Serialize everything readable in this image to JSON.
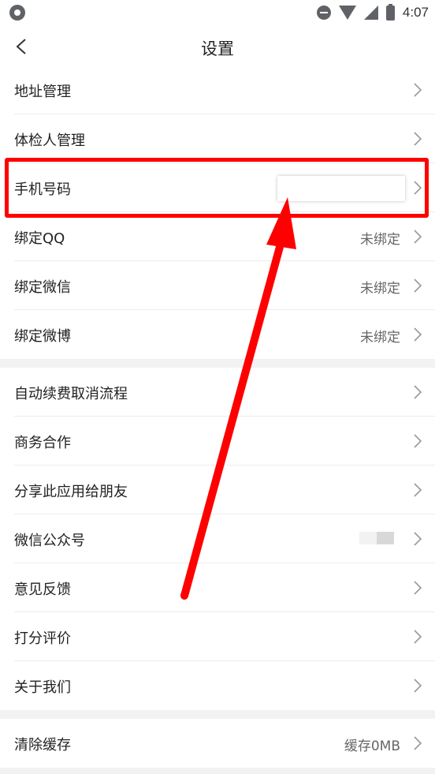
{
  "status_bar": {
    "time": "4:07"
  },
  "nav": {
    "title": "设置"
  },
  "group1": [
    {
      "label": "地址管理",
      "value": ""
    },
    {
      "label": "体检人管理",
      "value": ""
    },
    {
      "label": "手机号码",
      "value": ""
    },
    {
      "label": "绑定QQ",
      "value": "未绑定"
    },
    {
      "label": "绑定微信",
      "value": "未绑定"
    },
    {
      "label": "绑定微博",
      "value": "未绑定"
    }
  ],
  "group2": [
    {
      "label": "自动续费取消流程",
      "value": ""
    },
    {
      "label": "商务合作",
      "value": ""
    },
    {
      "label": "分享此应用给朋友",
      "value": ""
    },
    {
      "label": "微信公众号",
      "value": ""
    },
    {
      "label": "意见反馈",
      "value": ""
    },
    {
      "label": "打分评价",
      "value": ""
    },
    {
      "label": "关于我们",
      "value": ""
    }
  ],
  "group3": [
    {
      "label": "清除缓存",
      "value": "缓存0MB"
    }
  ],
  "colors": {
    "annotation": "#ff0000",
    "separator": "#f2f2f2"
  }
}
